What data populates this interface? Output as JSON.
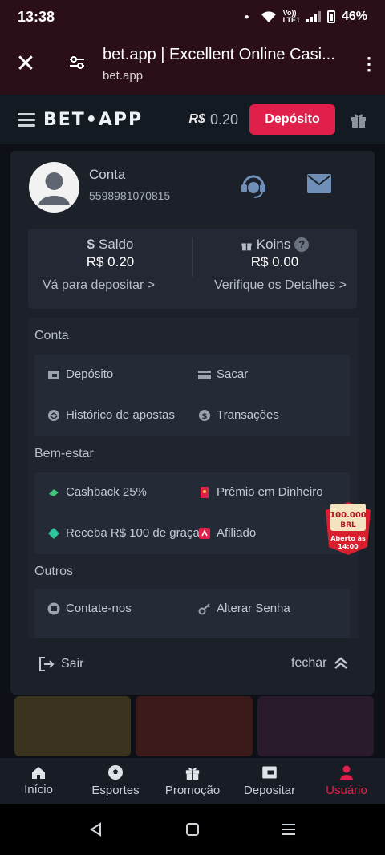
{
  "status_bar": {
    "time": "13:38",
    "signal_label_top": "Vo))",
    "signal_label_bottom": "LTE1",
    "battery": "46%"
  },
  "browser": {
    "title": "bet.app | Excellent Online Casi...",
    "url": "bet.app"
  },
  "header": {
    "logo": "BET•APP",
    "currency_symbol": "R$",
    "balance": "0.20",
    "deposit_label": "Depósito"
  },
  "profile": {
    "name": "Conta",
    "id": "5598981070815"
  },
  "wallet": {
    "saldo_label": "Saldo",
    "saldo_value": "R$ 0.20",
    "koins_label": "Koins",
    "koins_value": "R$ 0.00",
    "deposit_link": "Vá para depositar >",
    "details_link": "Verifique os Detalhes >"
  },
  "sections": {
    "conta": {
      "title": "Conta",
      "items": [
        "Depósito",
        "Sacar",
        "Histórico de apostas",
        "Transações"
      ]
    },
    "bem_estar": {
      "title": "Bem-estar",
      "items": [
        "Cashback 25%",
        "Prêmio em Dinheiro",
        "Receba R$ 100 de graça",
        "Afiliado"
      ]
    },
    "outros": {
      "title": "Outros",
      "items": [
        "Contate-nos",
        "Alterar Senha"
      ]
    }
  },
  "footer_actions": {
    "logout": "Sair",
    "close": "fechar"
  },
  "promo_badge": {
    "line1": "100.000",
    "line2": "BRL",
    "line3": "Aberto às",
    "line4": "14:00"
  },
  "bottom_nav": {
    "items": [
      "Início",
      "Esportes",
      "Promoção",
      "Depositar",
      "Usuário"
    ],
    "active_index": 4
  },
  "colors": {
    "accent": "#e0204a",
    "panel": "#1b2029",
    "background": "#0d1117"
  }
}
